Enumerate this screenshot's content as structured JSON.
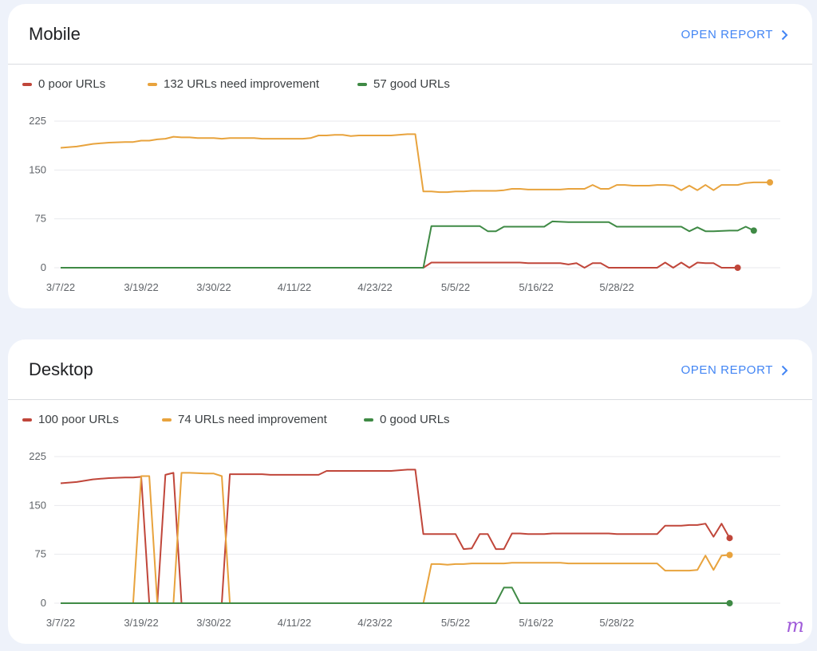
{
  "panels": [
    {
      "title": "Mobile",
      "open_report": "OPEN REPORT",
      "legend": [
        "0 poor URLs",
        "132 URLs need improvement",
        "57 good URLs"
      ]
    },
    {
      "title": "Desktop",
      "open_report": "OPEN REPORT",
      "legend": [
        "100 poor URLs",
        "74 URLs need improvement",
        "0 good URLs"
      ]
    }
  ],
  "colors": {
    "poor": "#c0463a",
    "needs": "#e8a33d",
    "good": "#3f8a45",
    "grid": "#e8eaed"
  },
  "chart_data": [
    {
      "type": "line",
      "title": "Mobile",
      "x_ticks": [
        "3/7/22",
        "3/19/22",
        "3/30/22",
        "4/11/22",
        "4/23/22",
        "5/5/22",
        "5/16/22",
        "5/28/22"
      ],
      "y_ticks": [
        0,
        75,
        150,
        225
      ],
      "ylim": [
        0,
        225
      ],
      "series": [
        {
          "name": "0 poor URLs",
          "color": "#c0463a",
          "values": [
            [
              1,
              0
            ],
            [
              46,
              0
            ],
            [
              47,
              8
            ],
            [
              58,
              8
            ],
            [
              59,
              7
            ],
            [
              63,
              7
            ],
            [
              64,
              5
            ],
            [
              65,
              7
            ],
            [
              66,
              0
            ],
            [
              67,
              7
            ],
            [
              68,
              7
            ],
            [
              69,
              0
            ],
            [
              75,
              0
            ],
            [
              76,
              8
            ],
            [
              77,
              0
            ],
            [
              78,
              8
            ],
            [
              79,
              0
            ],
            [
              80,
              8
            ],
            [
              81,
              7
            ],
            [
              82,
              7
            ],
            [
              83,
              0
            ],
            [
              85,
              0
            ]
          ]
        },
        {
          "name": "132 URLs need improvement",
          "color": "#e8a33d",
          "values": [
            [
              1,
              184
            ],
            [
              3,
              186
            ],
            [
              5,
              190
            ],
            [
              7,
              192
            ],
            [
              9,
              193
            ],
            [
              10,
              193
            ],
            [
              11,
              195
            ],
            [
              12,
              195
            ],
            [
              13,
              197
            ],
            [
              14,
              198
            ],
            [
              15,
              201
            ],
            [
              16,
              200
            ],
            [
              17,
              200
            ],
            [
              18,
              199
            ],
            [
              20,
              199
            ],
            [
              21,
              198
            ],
            [
              22,
              199
            ],
            [
              23,
              199
            ],
            [
              25,
              199
            ],
            [
              26,
              198
            ],
            [
              29,
              198
            ],
            [
              31,
              198
            ],
            [
              32,
              199
            ],
            [
              33,
              203
            ],
            [
              34,
              203
            ],
            [
              35,
              204
            ],
            [
              36,
              204
            ],
            [
              37,
              202
            ],
            [
              38,
              203
            ],
            [
              42,
              203
            ],
            [
              44,
              205
            ],
            [
              45,
              205
            ],
            [
              46,
              117
            ],
            [
              47,
              117
            ],
            [
              48,
              116
            ],
            [
              49,
              116
            ],
            [
              50,
              117
            ],
            [
              51,
              117
            ],
            [
              52,
              118
            ],
            [
              55,
              118
            ],
            [
              56,
              119
            ],
            [
              57,
              121
            ],
            [
              58,
              121
            ],
            [
              59,
              120
            ],
            [
              63,
              120
            ],
            [
              64,
              121
            ],
            [
              66,
              121
            ],
            [
              67,
              127
            ],
            [
              68,
              121
            ],
            [
              69,
              121
            ],
            [
              70,
              127
            ],
            [
              71,
              127
            ],
            [
              72,
              126
            ],
            [
              74,
              126
            ],
            [
              75,
              127
            ],
            [
              76,
              127
            ],
            [
              77,
              126
            ],
            [
              78,
              119
            ],
            [
              79,
              126
            ],
            [
              80,
              119
            ],
            [
              81,
              127
            ],
            [
              82,
              119
            ],
            [
              83,
              127
            ],
            [
              85,
              127
            ],
            [
              86,
              130
            ],
            [
              87,
              131
            ],
            [
              88,
              131
            ],
            [
              89,
              131
            ]
          ]
        },
        {
          "name": "57 good URLs",
          "color": "#3f8a45",
          "values": [
            [
              1,
              0
            ],
            [
              46,
              0
            ],
            [
              47,
              64
            ],
            [
              53,
              64
            ],
            [
              54,
              56
            ],
            [
              55,
              56
            ],
            [
              56,
              63
            ],
            [
              61,
              63
            ],
            [
              62,
              71
            ],
            [
              64,
              70
            ],
            [
              69,
              70
            ],
            [
              70,
              63
            ],
            [
              78,
              63
            ],
            [
              79,
              56
            ],
            [
              80,
              62
            ],
            [
              81,
              56
            ],
            [
              82,
              56
            ],
            [
              84,
              57
            ],
            [
              85,
              57
            ],
            [
              86,
              63
            ],
            [
              87,
              57
            ]
          ]
        }
      ]
    },
    {
      "type": "line",
      "title": "Desktop",
      "x_ticks": [
        "3/7/22",
        "3/19/22",
        "3/30/22",
        "4/11/22",
        "4/23/22",
        "5/5/22",
        "5/16/22",
        "5/28/22"
      ],
      "y_ticks": [
        0,
        75,
        150,
        225
      ],
      "ylim": [
        0,
        225
      ],
      "series": [
        {
          "name": "100 poor URLs",
          "color": "#c0463a",
          "values": [
            [
              1,
              184
            ],
            [
              3,
              186
            ],
            [
              5,
              190
            ],
            [
              7,
              192
            ],
            [
              9,
              193
            ],
            [
              10,
              193
            ],
            [
              11,
              194
            ],
            [
              12,
              0
            ],
            [
              13,
              0
            ],
            [
              14,
              197
            ],
            [
              15,
              200
            ],
            [
              16,
              0
            ],
            [
              21,
              0
            ],
            [
              22,
              198
            ],
            [
              26,
              198
            ],
            [
              27,
              197
            ],
            [
              33,
              197
            ],
            [
              34,
              203
            ],
            [
              36,
              203
            ],
            [
              38,
              203
            ],
            [
              42,
              203
            ],
            [
              44,
              205
            ],
            [
              45,
              205
            ],
            [
              46,
              106
            ],
            [
              47,
              106
            ],
            [
              48,
              106
            ],
            [
              49,
              106
            ],
            [
              50,
              106
            ],
            [
              51,
              83
            ],
            [
              52,
              84
            ],
            [
              53,
              106
            ],
            [
              54,
              106
            ],
            [
              55,
              83
            ],
            [
              56,
              83
            ],
            [
              57,
              107
            ],
            [
              58,
              107
            ],
            [
              59,
              106
            ],
            [
              61,
              106
            ],
            [
              62,
              107
            ],
            [
              64,
              107
            ],
            [
              69,
              107
            ],
            [
              70,
              106
            ],
            [
              74,
              106
            ],
            [
              75,
              106
            ],
            [
              76,
              119
            ],
            [
              77,
              119
            ],
            [
              78,
              119
            ],
            [
              79,
              120
            ],
            [
              80,
              120
            ],
            [
              81,
              122
            ],
            [
              82,
              102
            ],
            [
              83,
              122
            ],
            [
              84,
              100
            ]
          ]
        },
        {
          "name": "74 URLs need improvement",
          "color": "#e8a33d",
          "values": [
            [
              1,
              0
            ],
            [
              10,
              0
            ],
            [
              11,
              195
            ],
            [
              12,
              195
            ],
            [
              13,
              0
            ],
            [
              14,
              0
            ],
            [
              15,
              0
            ],
            [
              16,
              200
            ],
            [
              17,
              200
            ],
            [
              19,
              199
            ],
            [
              20,
              199
            ],
            [
              21,
              195
            ],
            [
              22,
              0
            ],
            [
              46,
              0
            ],
            [
              47,
              60
            ],
            [
              48,
              60
            ],
            [
              49,
              59
            ],
            [
              50,
              60
            ],
            [
              51,
              60
            ],
            [
              52,
              61
            ],
            [
              56,
              61
            ],
            [
              57,
              62
            ],
            [
              59,
              62
            ],
            [
              63,
              62
            ],
            [
              64,
              61
            ],
            [
              69,
              61
            ],
            [
              75,
              61
            ],
            [
              76,
              50
            ],
            [
              77,
              50
            ],
            [
              78,
              50
            ],
            [
              79,
              50
            ],
            [
              80,
              51
            ],
            [
              81,
              73
            ],
            [
              82,
              51
            ],
            [
              83,
              73
            ],
            [
              84,
              74
            ]
          ]
        },
        {
          "name": "0 good URLs",
          "color": "#3f8a45",
          "values": [
            [
              1,
              0
            ],
            [
              55,
              0
            ],
            [
              56,
              24
            ],
            [
              57,
              24
            ],
            [
              58,
              0
            ],
            [
              84,
              0
            ]
          ]
        }
      ]
    }
  ]
}
